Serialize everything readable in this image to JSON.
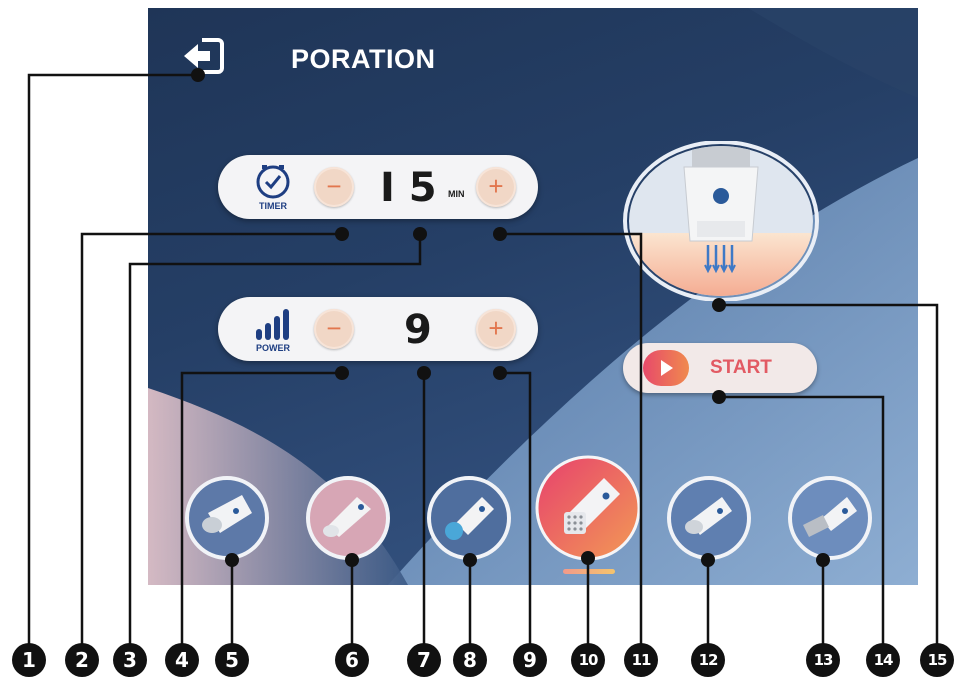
{
  "screen": {
    "title": "PORATION",
    "timer": {
      "caption": "TIMER",
      "minus_label": "−",
      "plus_label": "+",
      "value": "I 5",
      "unit": "MIN"
    },
    "power": {
      "caption": "POWER",
      "minus_label": "−",
      "plus_label": "+",
      "value": "9"
    },
    "start": {
      "label": "START"
    }
  },
  "callouts": [
    "1",
    "2",
    "3",
    "4",
    "5",
    "6",
    "7",
    "8",
    "9",
    "10",
    "11",
    "12",
    "13",
    "14",
    "15"
  ],
  "colors": {
    "accent": "#e8745a",
    "navy": "#1e3e82",
    "panel": "#f4f4f6"
  }
}
